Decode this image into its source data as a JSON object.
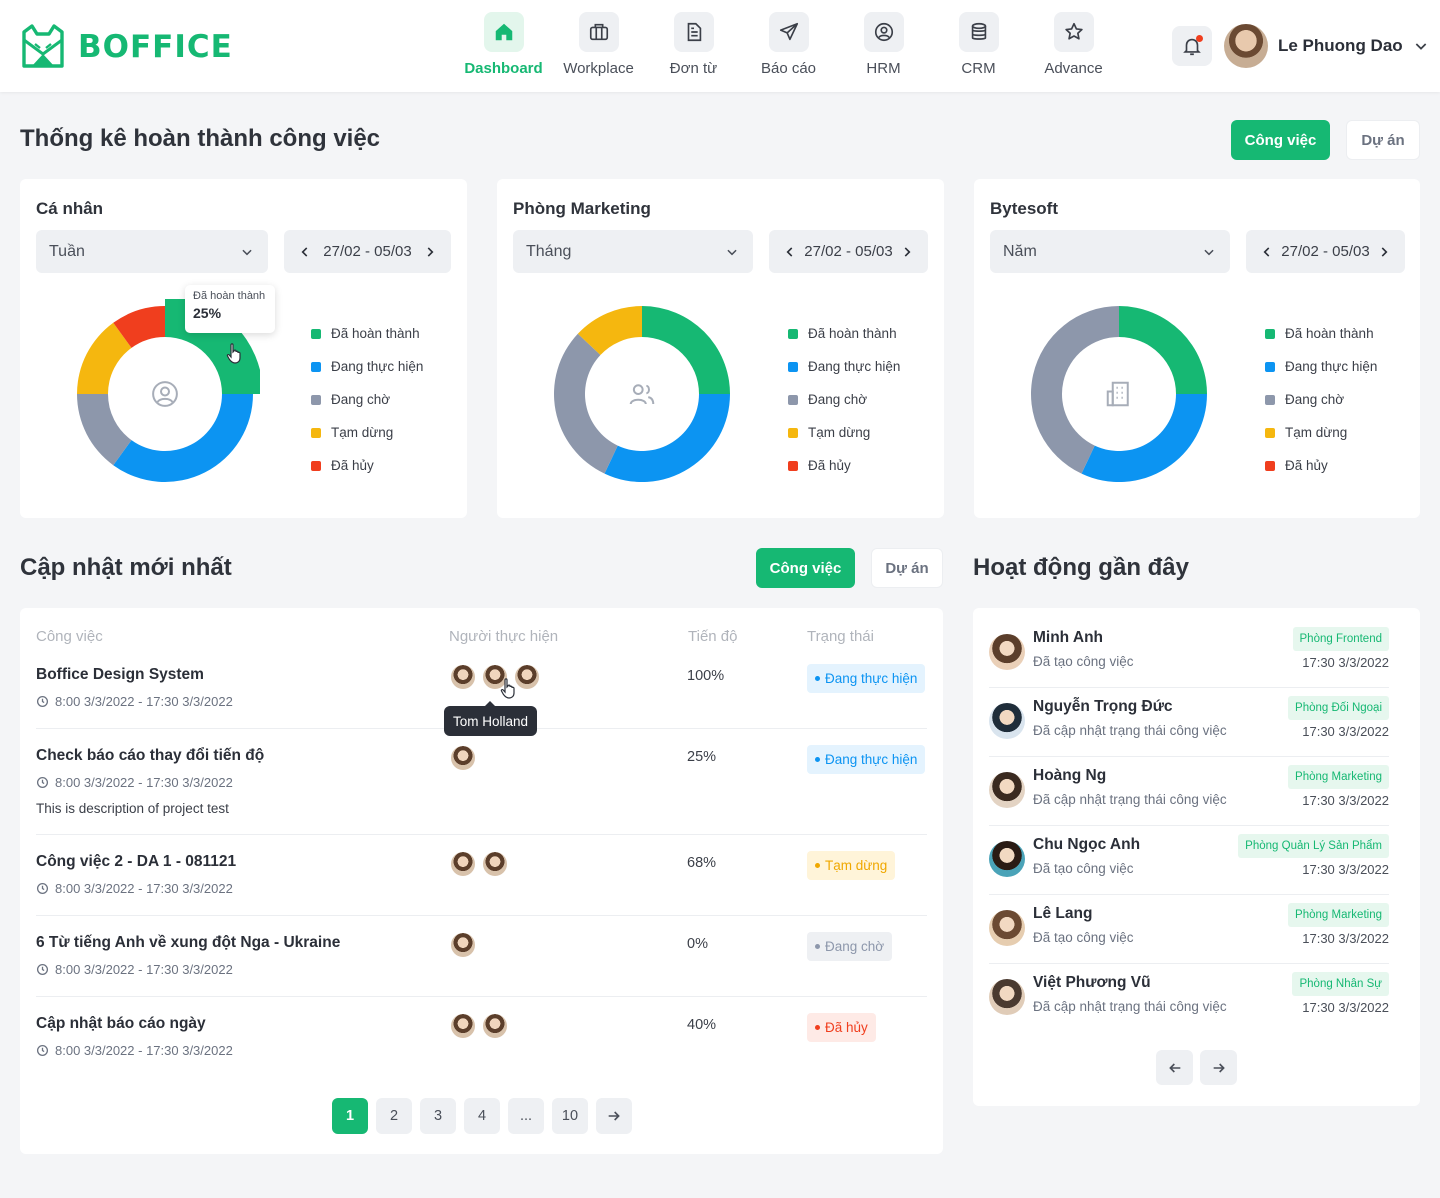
{
  "brand": {
    "name": "BOFFICE",
    "color": "#16b873"
  },
  "nav": [
    {
      "label": "Dashboard",
      "icon": "home-icon",
      "active": true
    },
    {
      "label": "Workplace",
      "icon": "briefcase-icon"
    },
    {
      "label": "Đơn từ",
      "icon": "document-icon"
    },
    {
      "label": "Báo cáo",
      "icon": "send-icon"
    },
    {
      "label": "HRM",
      "icon": "user-circle-icon"
    },
    {
      "label": "CRM",
      "icon": "database-icon"
    },
    {
      "label": "Advance",
      "icon": "star-icon"
    }
  ],
  "user": {
    "name": "Le Phuong Dao"
  },
  "stats": {
    "title": "Thống kê hoàn thành công việc",
    "toggle": {
      "primary": "Công việc",
      "secondary": "Dự án"
    },
    "legend": [
      "Đã hoàn thành",
      "Đang thực hiện",
      "Đang chờ",
      "Tạm dừng",
      "Đã hủy"
    ],
    "colors": [
      "#16b873",
      "#0c94f2",
      "#8d97ab",
      "#f5b70f",
      "#f03e1e"
    ],
    "cards": [
      {
        "title": "Cá nhân",
        "period": "Tuần",
        "range": "27/02 - 05/03",
        "icon": "user-circle-icon"
      },
      {
        "title": "Phòng Marketing",
        "period": "Tháng",
        "range": "27/02 - 05/03",
        "icon": "users-icon"
      },
      {
        "title": "Bytesoft",
        "period": "Năm",
        "range": "27/02 - 05/03",
        "icon": "building-icon"
      }
    ],
    "tooltip": {
      "label": "Đã hoàn thành",
      "value": "25%"
    }
  },
  "chart_data": [
    {
      "type": "pie",
      "title": "Cá nhân",
      "categories": [
        "Đã hoàn thành",
        "Đang thực hiện",
        "Đang chờ",
        "Tạm dừng",
        "Đã hủy"
      ],
      "values": [
        25,
        35,
        15,
        15,
        10
      ],
      "hole": true
    },
    {
      "type": "pie",
      "title": "Phòng Marketing",
      "categories": [
        "Đã hoàn thành",
        "Đang thực hiện",
        "Đang chờ",
        "Tạm dừng",
        "Đã hủy"
      ],
      "values": [
        25,
        32,
        30,
        13,
        0
      ],
      "hole": true
    },
    {
      "type": "pie",
      "title": "Bytesoft",
      "categories": [
        "Đã hoàn thành",
        "Đang thực hiện",
        "Đang chờ",
        "Tạm dừng",
        "Đã hủy"
      ],
      "values": [
        25,
        32,
        43,
        0,
        0
      ],
      "hole": true
    }
  ],
  "updates": {
    "title": "Cập nhật mới nhất",
    "toggle": {
      "primary": "Công việc",
      "secondary": "Dự án"
    },
    "columns": [
      "Công việc",
      "Người thực hiện",
      "Tiến độ",
      "Trạng thái"
    ],
    "tooltip": "Tom Holland",
    "rows": [
      {
        "title": "Boffice Design System",
        "time": "8:00 3/3/2022 - 17:30 3/3/2022",
        "desc": "",
        "avatars": 3,
        "progress": "100%",
        "status": "Đang thực hiện",
        "status_kind": "doing"
      },
      {
        "title": "Check báo cáo thay đổi tiến độ",
        "time": "8:00 3/3/2022 - 17:30 3/3/2022",
        "desc": "This is description of project test",
        "avatars": 1,
        "progress": "25%",
        "status": "Đang thực hiện",
        "status_kind": "doing"
      },
      {
        "title": "Công việc 2 - DA 1 - 081121",
        "time": "8:00 3/3/2022 - 17:30 3/3/2022",
        "desc": "",
        "avatars": 2,
        "progress": "68%",
        "status": "Tạm dừng",
        "status_kind": "paused"
      },
      {
        "title": "6 Từ tiếng Anh về xung đột Nga - Ukraine",
        "time": "8:00 3/3/2022 - 17:30 3/3/2022",
        "desc": "",
        "avatars": 1,
        "progress": "0%",
        "status": "Đang chờ",
        "status_kind": "waiting"
      },
      {
        "title": "Cập nhật báo cáo ngày",
        "time": "8:00 3/3/2022 - 17:30 3/3/2022",
        "desc": "",
        "avatars": 2,
        "progress": "40%",
        "status": "Đã hủy",
        "status_kind": "cancelled"
      }
    ],
    "pagination": [
      "1",
      "2",
      "3",
      "4",
      "...",
      "10"
    ]
  },
  "activity": {
    "title": "Hoạt động gần đây",
    "items": [
      {
        "name": "Minh Anh",
        "desc": "Đã tạo công việc",
        "dept": "Phòng Frontend",
        "time": "17:30 3/3/2022"
      },
      {
        "name": "Nguyễn Trọng Đức",
        "desc": "Đã cập nhật trạng thái công việc",
        "dept": "Phòng Đối Ngoại",
        "time": "17:30 3/3/2022"
      },
      {
        "name": "Hoàng Ng",
        "desc": "Đã cập nhật trạng thái công việc",
        "dept": "Phòng Marketing",
        "time": "17:30 3/3/2022"
      },
      {
        "name": "Chu Ngọc Anh",
        "desc": "Đã tạo công việc",
        "dept": "Phòng Quản Lý Sản Phẩm",
        "time": "17:30 3/3/2022"
      },
      {
        "name": "Lê Lang",
        "desc": "Đã tạo công việc",
        "dept": "Phòng Marketing",
        "time": "17:30 3/3/2022"
      },
      {
        "name": "Việt Phương Vũ",
        "desc": "Đã cập nhật trạng thái công việc",
        "dept": "Phòng Nhân Sự",
        "time": "17:30 3/3/2022"
      }
    ]
  }
}
